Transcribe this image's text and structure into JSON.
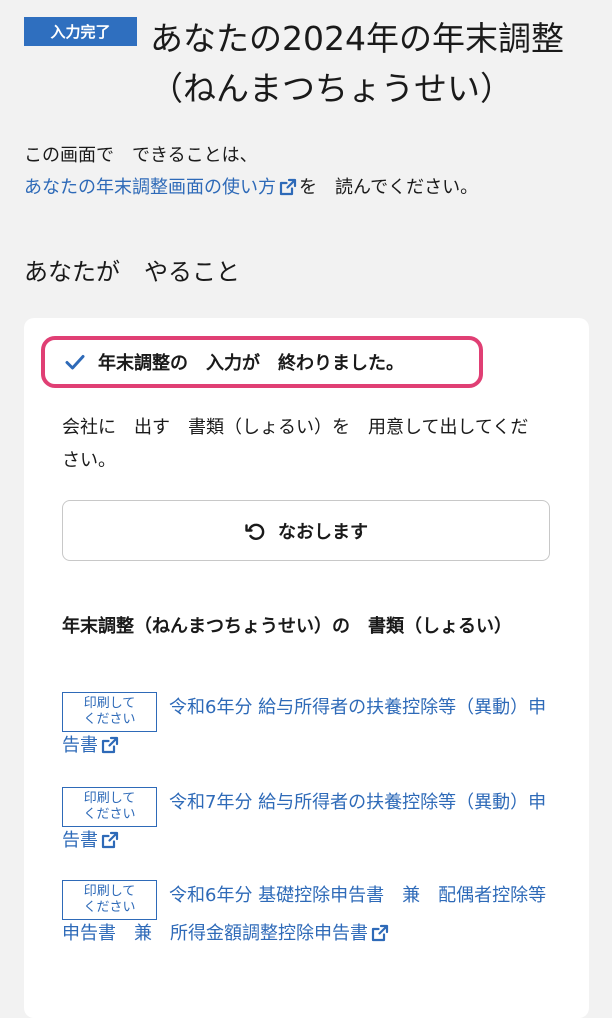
{
  "header": {
    "status_badge": "入力完了",
    "title": "あなたの2024年の年末調整（ねんまつちょうせい）"
  },
  "intro": {
    "text_before": "この画面で　できることは、",
    "link_text": "あなたの年末調整画面の使い方",
    "text_after": "を　読んでください。"
  },
  "section": {
    "title": "あなたが　やること"
  },
  "card": {
    "completion_message": "年末調整の　入力が　終わりました。",
    "instruction": "会社に　出す　書類（しょるい）を　用意して出してください。",
    "redo_button_label": "なおします",
    "documents_heading": "年末調整（ねんまつちょうせい）の　書類（しょるい）",
    "documents": [
      {
        "tag_line1": "印刷して",
        "tag_line2": "ください",
        "title": "令和6年分 給与所得者の扶養控除等（異動）申告書"
      },
      {
        "tag_line1": "印刷して",
        "tag_line2": "ください",
        "title": "令和7年分 給与所得者の扶養控除等（異動）申告書"
      },
      {
        "tag_line1": "印刷して",
        "tag_line2": "ください",
        "title": "令和6年分 基礎控除申告書　兼　配偶者控除等申告書　兼　所得金額調整控除申告書"
      }
    ]
  },
  "colors": {
    "accent_blue": "#2e6ab8",
    "badge_blue": "#2f6fbf",
    "highlight_pink": "#e03f74",
    "background": "#f2f2f2"
  },
  "icons": {
    "external_link": "external-link-icon",
    "check": "check-icon",
    "redo": "undo-arrow-icon"
  }
}
